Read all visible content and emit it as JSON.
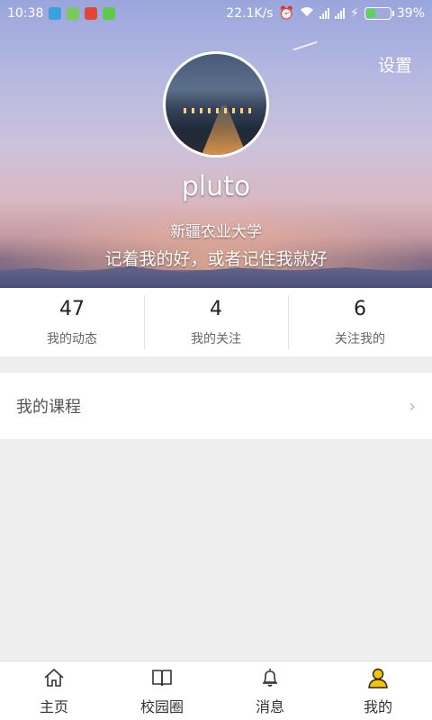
{
  "status_bar": {
    "time": "10:38",
    "speed": "22.1K/s",
    "battery": "39%",
    "battery_level": 0.39,
    "icons": [
      "usb-icon",
      "app-icon",
      "weibo-icon",
      "wechat-icon",
      "alarm-icon",
      "wifi-icon",
      "signal-icon",
      "signal-icon",
      "charging-icon",
      "battery-icon"
    ]
  },
  "header": {
    "settings_label": "设置",
    "username": "pluto",
    "school": "新疆农业大学",
    "motto": "记着我的好，或者记住我就好"
  },
  "stats": [
    {
      "count": "47",
      "label": "我的动态"
    },
    {
      "count": "4",
      "label": "我的关注"
    },
    {
      "count": "6",
      "label": "关注我的"
    }
  ],
  "course_row": {
    "label": "我的课程",
    "chevron": "›"
  },
  "bottom_nav": [
    {
      "label": "主页",
      "icon": "home-icon"
    },
    {
      "label": "校园圈",
      "icon": "book-icon"
    },
    {
      "label": "消息",
      "icon": "bell-icon"
    },
    {
      "label": "我的",
      "icon": "user-icon",
      "active": true
    }
  ],
  "colors": {
    "active_nav": "#f5c400",
    "background": "#eeeeee"
  }
}
